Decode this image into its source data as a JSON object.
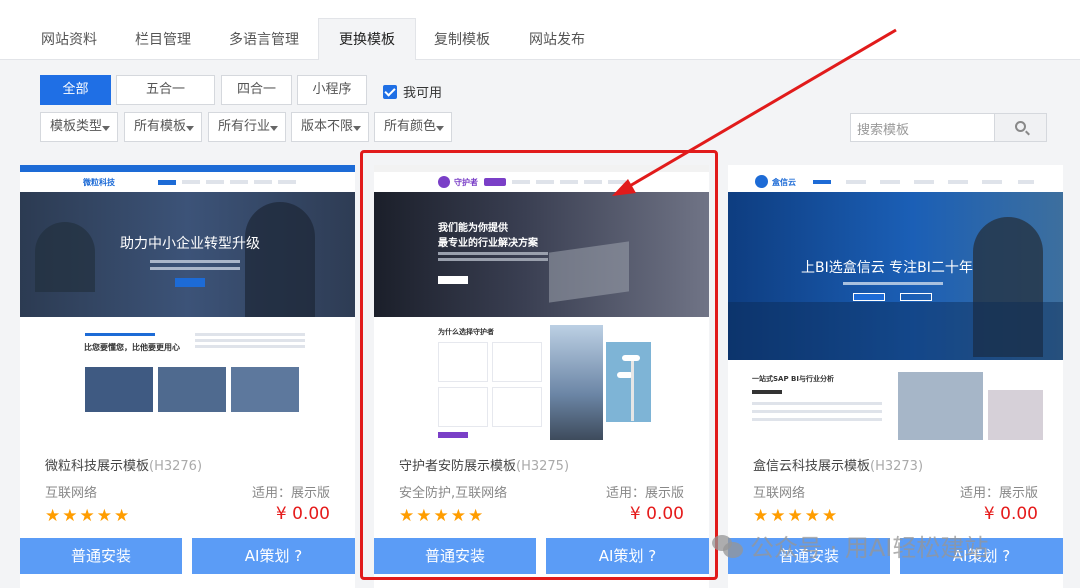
{
  "tabs": [
    "网站资料",
    "栏目管理",
    "多语言管理",
    "更换模板",
    "复制模板",
    "网站发布"
  ],
  "active_tab": "更换模板",
  "filters": {
    "types": [
      "全部",
      "五合一",
      "四合一",
      "小程序"
    ],
    "available_label": "我可用",
    "dropdowns": [
      "模板类型",
      "所有模板",
      "所有行业",
      "版本不限",
      "所有颜色"
    ],
    "search_placeholder": "搜索模板"
  },
  "cards": [
    {
      "name": "微粒科技展示模板",
      "code": "(H3276)",
      "tags": "互联网络",
      "usage": "适用：展示版",
      "stars": "★★★★★",
      "price": "¥ 0.00",
      "install": "普通安装",
      "ai": "AI策划 ?",
      "preview": {
        "logo": "微粒科技",
        "hero": "助力中小企业转型升级",
        "section": "比您要懂您，比他要更用心"
      }
    },
    {
      "name": "守护者安防展示模板",
      "code": "(H3275)",
      "tags": "安全防护,互联网络",
      "usage": "适用：展示版",
      "stars": "★★★★★",
      "price": "¥ 0.00",
      "install": "普通安装",
      "ai": "AI策划 ?",
      "preview": {
        "logo": "守护者",
        "hero_line1": "我们能为你提供",
        "hero_line2": "最专业的行业解决方案",
        "section": "为什么选择守护者"
      }
    },
    {
      "name": "盒信云科技展示模板",
      "code": "(H3273)",
      "tags": "互联网络",
      "usage": "适用：展示版",
      "stars": "★★★★★",
      "price": "¥ 0.00",
      "install": "普通安装",
      "ai": "AI策划 ?",
      "preview": {
        "logo": "盒信云",
        "hero": "上BI选盒信云 专注BI二十年",
        "section": "一站式SAP  BI与行业分析"
      }
    }
  ],
  "watermark": "公众号 · 用AI轻松建站"
}
